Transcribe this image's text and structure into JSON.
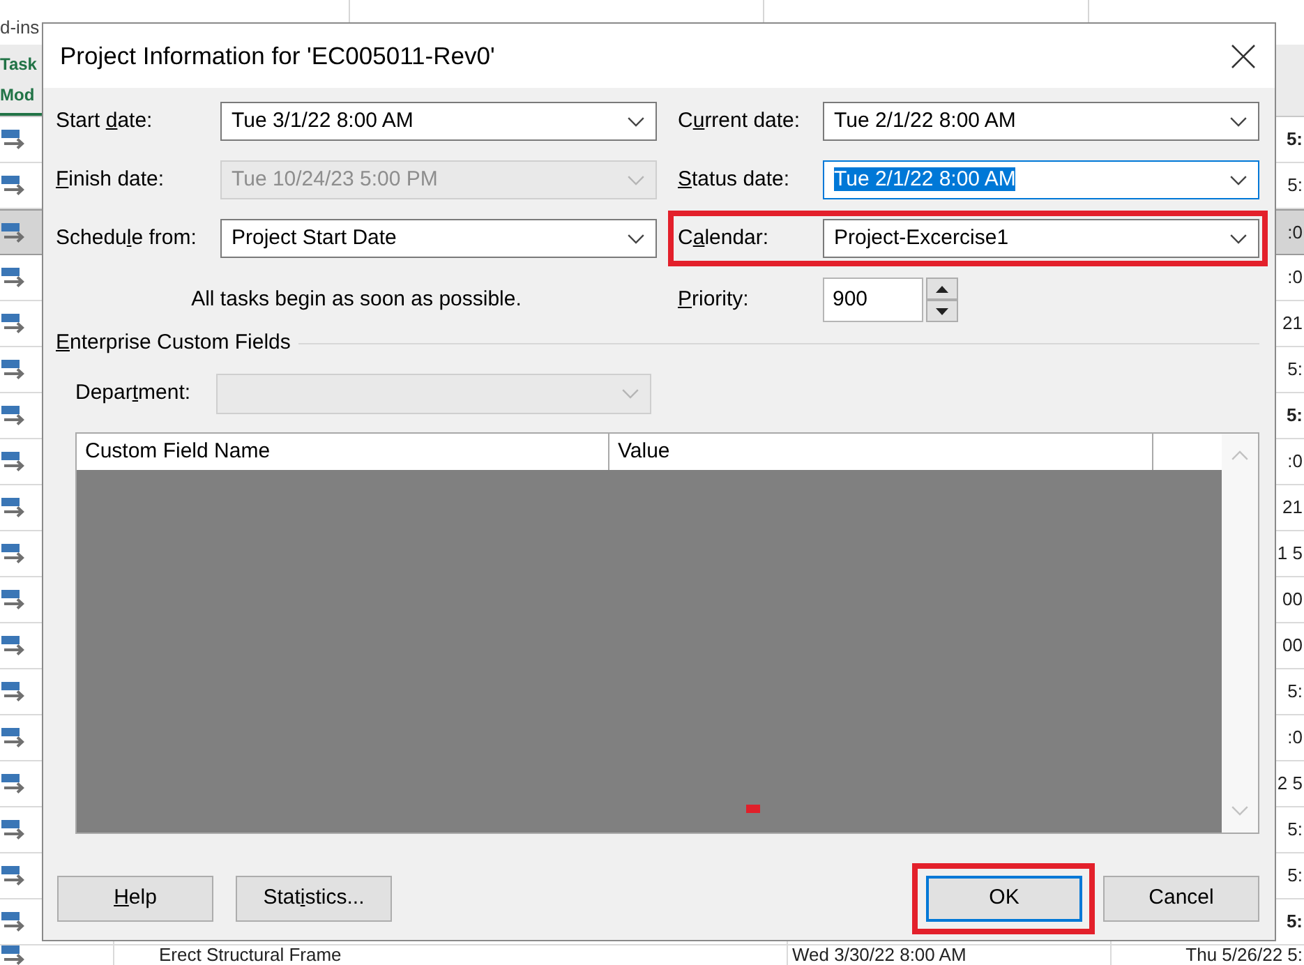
{
  "app": {
    "ribbon_tab": "d-ins",
    "mode_header": [
      "Task",
      "Mod"
    ],
    "rows": [
      {
        "selected": false,
        "summary": true,
        "finish": "5:"
      },
      {
        "selected": false,
        "summary": false,
        "finish": "5:"
      },
      {
        "selected": true,
        "summary": false,
        "finish": ":0"
      },
      {
        "selected": false,
        "summary": false,
        "finish": ":0"
      },
      {
        "selected": false,
        "summary": false,
        "finish": "21"
      },
      {
        "selected": false,
        "summary": false,
        "finish": "5:"
      },
      {
        "selected": false,
        "summary": true,
        "finish": "5:"
      },
      {
        "selected": false,
        "summary": false,
        "finish": ":0"
      },
      {
        "selected": false,
        "summary": false,
        "finish": "21"
      },
      {
        "selected": false,
        "summary": false,
        "finish": "1 5"
      },
      {
        "selected": false,
        "summary": false,
        "finish": "00"
      },
      {
        "selected": false,
        "summary": false,
        "finish": "00"
      },
      {
        "selected": false,
        "summary": false,
        "finish": "5:"
      },
      {
        "selected": false,
        "summary": false,
        "finish": ":0"
      },
      {
        "selected": false,
        "summary": false,
        "finish": "2 5"
      },
      {
        "selected": false,
        "summary": false,
        "finish": "5:"
      },
      {
        "selected": false,
        "summary": false,
        "finish": "5:"
      },
      {
        "selected": false,
        "summary": true,
        "finish": "5:"
      },
      {
        "selected": false,
        "summary": false,
        "task_name": "Erect Structural Frame",
        "start": "Wed 3/30/22 8:00 AM",
        "finish": "Thu 5/26/22 5:"
      }
    ]
  },
  "dialog": {
    "title": "Project Information for 'EC005011-Rev0'",
    "left_fields": [
      {
        "kind": "combo",
        "label": [
          {
            "text": "Start ",
            "underlined": false
          },
          {
            "text": "d",
            "underlined": true
          },
          {
            "text": "ate:",
            "underlined": false
          }
        ],
        "value": "Tue 3/1/22 8:00 AM",
        "disabled": false,
        "focused": false,
        "highlighted": false
      },
      {
        "kind": "combo",
        "label": [
          {
            "text": "F",
            "underlined": true
          },
          {
            "text": "inish date:",
            "underlined": false
          }
        ],
        "value": "Tue 10/24/23 5:00 PM",
        "disabled": true,
        "focused": false,
        "highlighted": false
      },
      {
        "kind": "combo",
        "label": [
          {
            "text": "Schedu",
            "underlined": false
          },
          {
            "text": "l",
            "underlined": true
          },
          {
            "text": "e from:",
            "underlined": false
          }
        ],
        "value": "Project Start Date",
        "disabled": false,
        "focused": false,
        "highlighted": false
      }
    ],
    "note": "All tasks begin as soon as possible.",
    "right_fields": [
      {
        "kind": "combo",
        "label": [
          {
            "text": "C",
            "underlined": false
          },
          {
            "text": "u",
            "underlined": true
          },
          {
            "text": "rrent date:",
            "underlined": false
          }
        ],
        "value": "Tue 2/1/22 8:00 AM",
        "disabled": false,
        "focused": false,
        "highlighted": false
      },
      {
        "kind": "combo",
        "label": [
          {
            "text": "S",
            "underlined": true
          },
          {
            "text": "tatus date:",
            "underlined": false
          }
        ],
        "value": "Tue 2/1/22 8:00 AM",
        "disabled": false,
        "focused": true,
        "highlighted": false
      },
      {
        "kind": "combo",
        "label": [
          {
            "text": "C",
            "underlined": false
          },
          {
            "text": "a",
            "underlined": true
          },
          {
            "text": "lendar:",
            "underlined": false
          }
        ],
        "value": "Project-Excercise1",
        "disabled": false,
        "focused": false,
        "highlighted": true
      },
      {
        "kind": "spin",
        "label": [
          {
            "text": "P",
            "underlined": true
          },
          {
            "text": "riority:",
            "underlined": false
          }
        ],
        "value": "900"
      }
    ],
    "enterprise": {
      "title": [
        {
          "text": "E",
          "underlined": true
        },
        {
          "text": "nterprise Custom Fields",
          "underlined": false
        }
      ],
      "department": {
        "label": [
          {
            "text": "Depar",
            "underlined": false
          },
          {
            "text": "t",
            "underlined": true
          },
          {
            "text": "ment:",
            "underlined": false
          }
        ],
        "disabled": true
      },
      "columns": [
        "Custom Field Name",
        "Value"
      ]
    },
    "left_buttons": [
      {
        "label": [
          {
            "text": "H",
            "underlined": true
          },
          {
            "text": "elp",
            "underlined": false
          }
        ],
        "default": false,
        "highlighted": false
      },
      {
        "label": [
          {
            "text": "Stat",
            "underlined": false
          },
          {
            "text": "i",
            "underlined": true
          },
          {
            "text": "stics...",
            "underlined": false
          }
        ],
        "default": false,
        "highlighted": false
      }
    ],
    "right_buttons": [
      {
        "label": [
          {
            "text": "OK",
            "underlined": false
          }
        ],
        "default": true,
        "highlighted": true
      },
      {
        "label": [
          {
            "text": "Cancel",
            "underlined": false
          }
        ],
        "default": false,
        "highlighted": false
      }
    ]
  }
}
